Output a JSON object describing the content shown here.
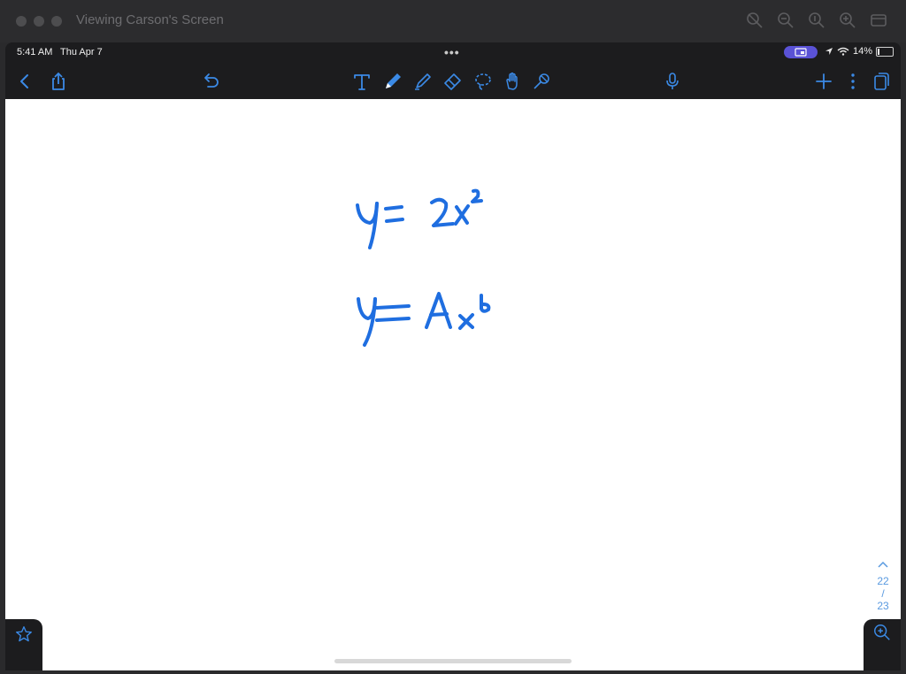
{
  "window": {
    "title": "Viewing Carson's Screen"
  },
  "status_bar": {
    "time": "5:41 AM",
    "date": "Thu Apr 7",
    "battery": "14%"
  },
  "toolbar": {
    "left_icons": [
      "back-icon",
      "share-icon",
      "undo-icon"
    ],
    "center_icons": [
      "text-tool-icon",
      "pen-tool-icon",
      "highlighter-tool-icon",
      "eraser-tool-icon",
      "lasso-tool-icon",
      "hand-tool-icon",
      "shapes-tool-icon"
    ],
    "right_icons": [
      "microphone-icon",
      "add-icon",
      "more-icon",
      "pages-icon"
    ],
    "accent": "#3b8ae6"
  },
  "canvas": {
    "ink_color": "#1f6ee0",
    "equations": [
      "y = 2x²",
      "y = Ax^b"
    ]
  },
  "page_nav": {
    "current": "22",
    "separator": "/",
    "total": "23"
  }
}
